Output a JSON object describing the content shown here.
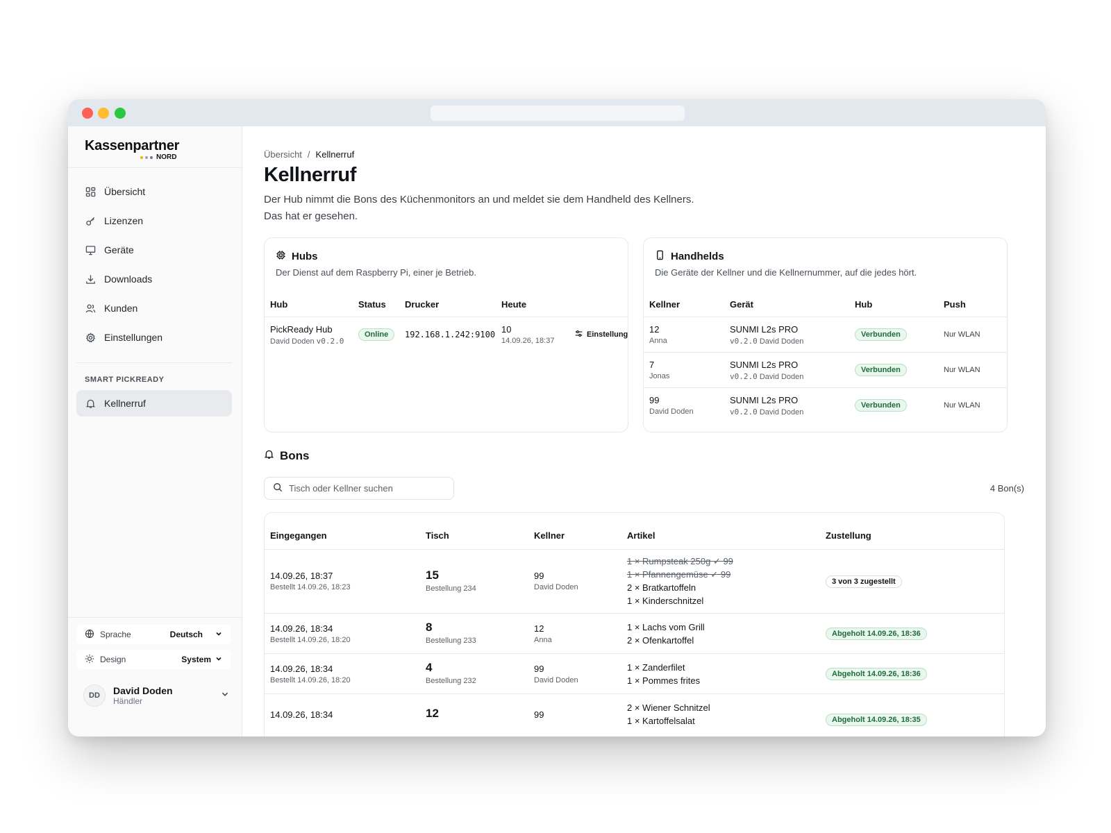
{
  "window": {},
  "sidebar": {
    "logo": {
      "main": "Kassenpartner",
      "sub": "NORD"
    },
    "nav": [
      {
        "label": "Übersicht",
        "icon": "grid-icon"
      },
      {
        "label": "Lizenzen",
        "icon": "key-icon"
      },
      {
        "label": "Geräte",
        "icon": "monitor-icon"
      },
      {
        "label": "Downloads",
        "icon": "download-icon"
      },
      {
        "label": "Kunden",
        "icon": "users-icon"
      },
      {
        "label": "Einstellungen",
        "icon": "gear-icon"
      }
    ],
    "section_label": "SMART PICKREADY",
    "active_item": {
      "label": "Kellnerruf",
      "icon": "bell-icon"
    },
    "language": {
      "label": "Sprache",
      "value": "Deutsch"
    },
    "design": {
      "label": "Design",
      "value": "System"
    },
    "user": {
      "initials": "DD",
      "name": "David Doden",
      "role": "Händler"
    }
  },
  "main": {
    "breadcrumb": {
      "root": "Übersicht",
      "sep": "/",
      "current": "Kellnerruf"
    },
    "title": "Kellnerruf",
    "description": [
      "Der Hub nimmt die Bons des Küchenmonitors an und meldet sie dem Handheld des Kellners.",
      "Das hat er gesehen."
    ]
  },
  "hubs": {
    "title": "Hubs",
    "subtitle": "Der Dienst auf dem Raspberry Pi, einer je Betrieb.",
    "columns": {
      "hub": "Hub",
      "status": "Status",
      "printer": "Drucker",
      "today": "Heute"
    },
    "rows": [
      {
        "name": "PickReady Hub",
        "owner": "David Doden",
        "version": "v0.2.0",
        "status": "Online",
        "printer": "192.168.1.242:9100",
        "today_count": "10",
        "today_time": "14.09.26, 18:37",
        "action": "Einstellung"
      }
    ]
  },
  "handhelds": {
    "title": "Handhelds",
    "subtitle": "Die Geräte der Kellner und die Kellnernummer, auf die jedes hört.",
    "columns": {
      "waiter": "Kellner",
      "device": "Gerät",
      "hub": "Hub",
      "push": "Push"
    },
    "rows": [
      {
        "number": "12",
        "name": "Anna",
        "device": "SUNMI L2s PRO",
        "version": "v0.2.0",
        "owner": "David Doden",
        "hub": "Verbunden",
        "push": "Nur WLAN"
      },
      {
        "number": "7",
        "name": "Jonas",
        "device": "SUNMI L2s PRO",
        "version": "v0.2.0",
        "owner": "David Doden",
        "hub": "Verbunden",
        "push": "Nur WLAN"
      },
      {
        "number": "99",
        "name": "David Doden",
        "device": "SUNMI L2s PRO",
        "version": "v0.2.0",
        "owner": "David Doden",
        "hub": "Verbunden",
        "push": "Nur WLAN"
      }
    ]
  },
  "bons": {
    "title": "Bons",
    "search_placeholder": "Tisch oder Kellner suchen",
    "count": "4 Bon(s)",
    "columns": {
      "received": "Eingegangen",
      "table": "Tisch",
      "waiter": "Kellner",
      "items": "Artikel",
      "delivery": "Zustellung"
    },
    "rows": [
      {
        "received": "14.09.26, 18:37",
        "ordered": "Bestellt 14.09.26, 18:23",
        "table": "15",
        "order": "Bestellung 234",
        "waiter_no": "99",
        "waiter_name": "David Doden",
        "items": [
          {
            "text": "1 × Rumpsteak 250g ✓ 99",
            "done": true
          },
          {
            "text": "1 × Pfannengemüse ✓ 99",
            "done": true
          },
          {
            "text": "2 × Bratkartoffeln",
            "done": false
          },
          {
            "text": "1 × Kinderschnitzel",
            "done": false
          }
        ],
        "delivery": "3 von 3 zugestellt",
        "delivery_kind": "neutral"
      },
      {
        "received": "14.09.26, 18:34",
        "ordered": "Bestellt 14.09.26, 18:20",
        "table": "8",
        "order": "Bestellung 233",
        "waiter_no": "12",
        "waiter_name": "Anna",
        "items": [
          {
            "text": "1 × Lachs vom Grill",
            "done": false
          },
          {
            "text": "2 × Ofenkartoffel",
            "done": false
          }
        ],
        "delivery": "Abgeholt 14.09.26, 18:36",
        "delivery_kind": "success"
      },
      {
        "received": "14.09.26, 18:34",
        "ordered": "Bestellt 14.09.26, 18:20",
        "table": "4",
        "order": "Bestellung 232",
        "waiter_no": "99",
        "waiter_name": "David Doden",
        "items": [
          {
            "text": "1 × Zanderfilet",
            "done": false
          },
          {
            "text": "1 × Pommes frites",
            "done": false
          }
        ],
        "delivery": "Abgeholt 14.09.26, 18:36",
        "delivery_kind": "success"
      },
      {
        "received": "14.09.26, 18:34",
        "ordered": "",
        "table": "12",
        "order": "",
        "waiter_no": "99",
        "waiter_name": "",
        "items": [
          {
            "text": "2 × Wiener Schnitzel",
            "done": false
          },
          {
            "text": "1 × Kartoffelsalat",
            "done": false
          }
        ],
        "delivery": "Abgeholt 14.09.26, 18:35",
        "delivery_kind": "success"
      }
    ]
  },
  "colors": {
    "success_bg": "#e9f7ee",
    "success_text": "#1f6b3a",
    "active_nav": "#e8eaed",
    "window_bar": "#e3e8ee"
  }
}
